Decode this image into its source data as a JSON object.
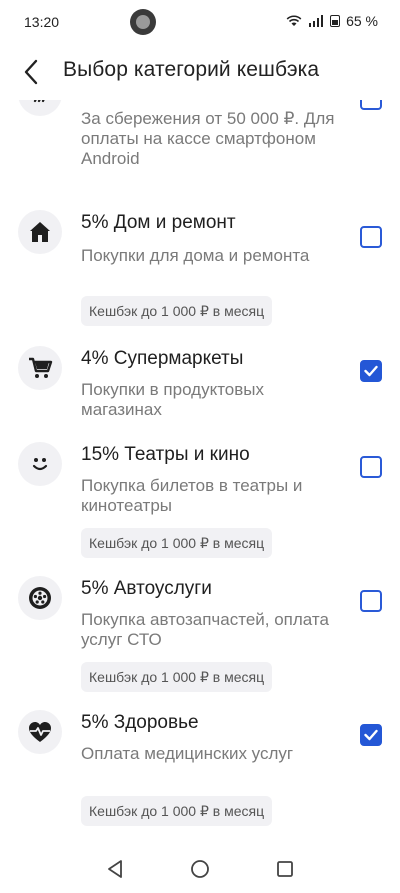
{
  "status": {
    "time": "13:20",
    "battery": "65 %"
  },
  "header": {
    "title": "Выбор категорий кешбэка",
    "back_icon": "chevron-left-icon"
  },
  "items": [
    {
      "title": "",
      "description": "За сбережения от 50 000 ₽. Для оплаты на кассе смартфоном Android",
      "badge": "",
      "icon": "nfc-icon",
      "checked": false
    },
    {
      "title": "5% Дом и ремонт",
      "description": "Покупки для дома и ремонта",
      "badge": "Кешбэк до 1 000 ₽ в месяц",
      "icon": "house-icon",
      "checked": false
    },
    {
      "title": "4% Супермаркеты",
      "description": "Покупки в продуктовых магазинах",
      "badge": "",
      "icon": "cart-icon",
      "checked": true
    },
    {
      "title": "15% Театры и кино",
      "description": "Покупка билетов в театры и кинотеатры",
      "badge": "Кешбэк до 1 000 ₽ в месяц",
      "icon": "smile-icon",
      "checked": false
    },
    {
      "title": "5% Автоуслуги",
      "description": "Покупка автозапчастей, оплата услуг СТО",
      "badge": "Кешбэк до 1 000 ₽ в месяц",
      "icon": "wheel-icon",
      "checked": false
    },
    {
      "title": "5% Здоровье",
      "description": "Оплата медицинских услуг",
      "badge": "Кешбэк до 1 000 ₽ в месяц",
      "icon": "heart-pulse-icon",
      "checked": true
    }
  ],
  "colors": {
    "accent": "#2457d6",
    "icon_bg": "#f1f1f4",
    "secondary_text": "#7a7a7a"
  }
}
